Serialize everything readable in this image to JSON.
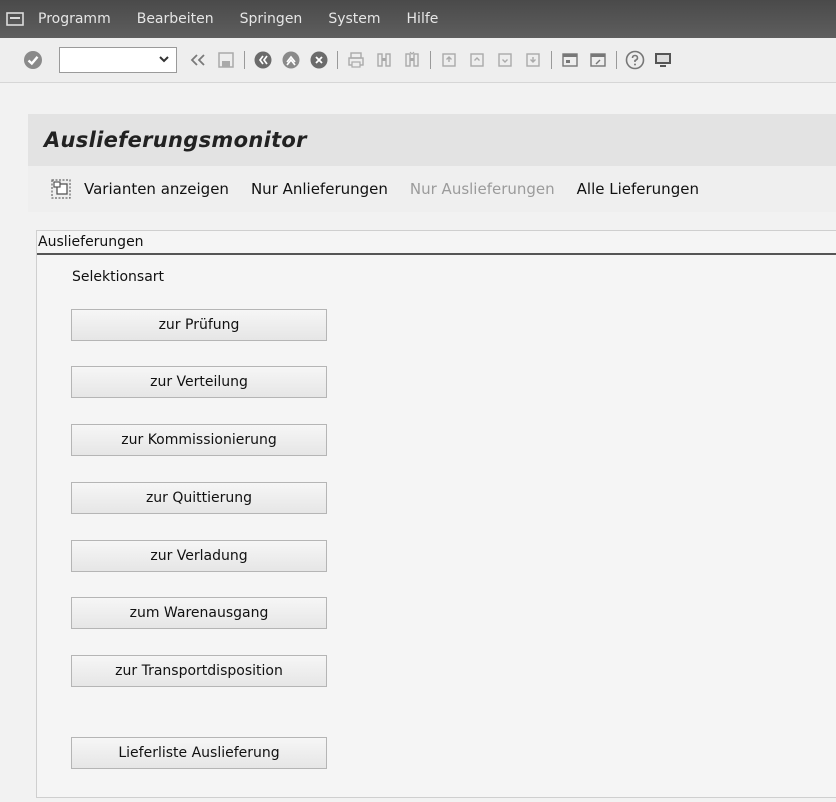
{
  "menubar": {
    "items": [
      {
        "label": "Programm"
      },
      {
        "label": "Bearbeiten"
      },
      {
        "label": "Springen"
      },
      {
        "label": "System"
      },
      {
        "label": "Hilfe"
      }
    ]
  },
  "toolbar": {
    "command_value": "",
    "icons": [
      "enter-check-icon",
      "back-double-arrow-icon",
      "save-icon",
      "back-icon",
      "exit-icon",
      "cancel-icon",
      "print-icon",
      "find-icon",
      "find-next-icon",
      "first-page-icon",
      "previous-page-icon",
      "next-page-icon",
      "last-page-icon",
      "create-session-icon",
      "shortcut-icon",
      "help-icon",
      "layout-icon"
    ]
  },
  "title": "Auslieferungsmonitor",
  "apptoolbar": {
    "icon": "variants-icon",
    "items": [
      {
        "label": "Varianten anzeigen",
        "enabled": true
      },
      {
        "label": "Nur Anlieferungen",
        "enabled": true
      },
      {
        "label": "Nur Auslieferungen",
        "enabled": false
      },
      {
        "label": "Alle Lieferungen",
        "enabled": true
      }
    ]
  },
  "content": {
    "caption": "Auslieferungen",
    "section_label": "Selektionsart",
    "buttons": [
      {
        "label": "zur Prüfung"
      },
      {
        "label": "zur Verteilung"
      },
      {
        "label": "zur Kommissionierung"
      },
      {
        "label": "zur Quittierung"
      },
      {
        "label": "zur Verladung"
      },
      {
        "label": "zum Warenausgang"
      },
      {
        "label": "zur Transportdisposition"
      },
      {
        "label": "Lieferliste Auslieferung"
      }
    ]
  },
  "colors": {
    "menubar_bg": "#555555",
    "toolbar_bg": "#eeeeee",
    "title_bg": "#e3e3e3",
    "disabled_text": "#9b9b9b"
  }
}
